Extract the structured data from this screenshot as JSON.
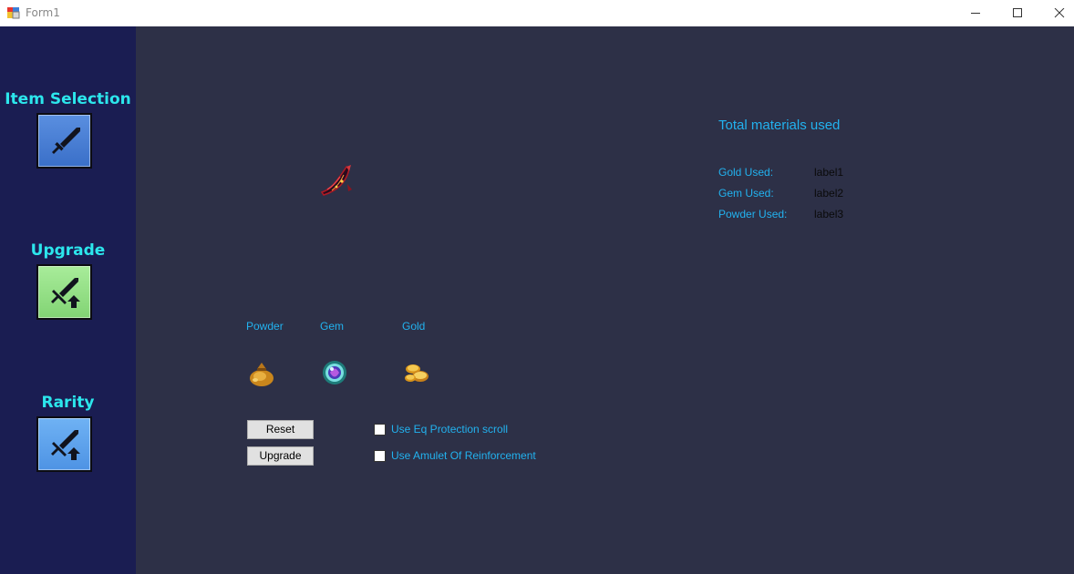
{
  "window": {
    "title": "Form1"
  },
  "sidebar": {
    "items": [
      {
        "label": "Item Selection",
        "icon": "sword-icon",
        "color": "#4a7fd4"
      },
      {
        "label": "Upgrade",
        "icon": "sword-upgrade-icon",
        "color": "#96e08a"
      },
      {
        "label": "Rarity",
        "icon": "sword-upgrade-icon",
        "color": "#5ea4ec"
      }
    ]
  },
  "materials": {
    "heading": "Total materials used",
    "rows": [
      {
        "label": "Gold Used:",
        "value": "label1"
      },
      {
        "label": "Gem Used:",
        "value": "label2"
      },
      {
        "label": "Powder Used:",
        "value": "label3"
      }
    ]
  },
  "resources": [
    {
      "label": "Powder",
      "icon": "powder-bag-icon"
    },
    {
      "label": "Gem",
      "icon": "gem-icon"
    },
    {
      "label": "Gold",
      "icon": "gold-coins-icon"
    }
  ],
  "actions": {
    "reset_label": "Reset",
    "upgrade_label": "Upgrade"
  },
  "options": [
    {
      "label": "Use Eq Protection scroll",
      "checked": false
    },
    {
      "label": "Use Amulet Of Reinforcement",
      "checked": false
    }
  ],
  "colors": {
    "sidebar_bg": "#1a1d52",
    "main_bg": "#2d3047",
    "nav_title": "#2ce6ec",
    "label_text": "#22b2ef"
  }
}
